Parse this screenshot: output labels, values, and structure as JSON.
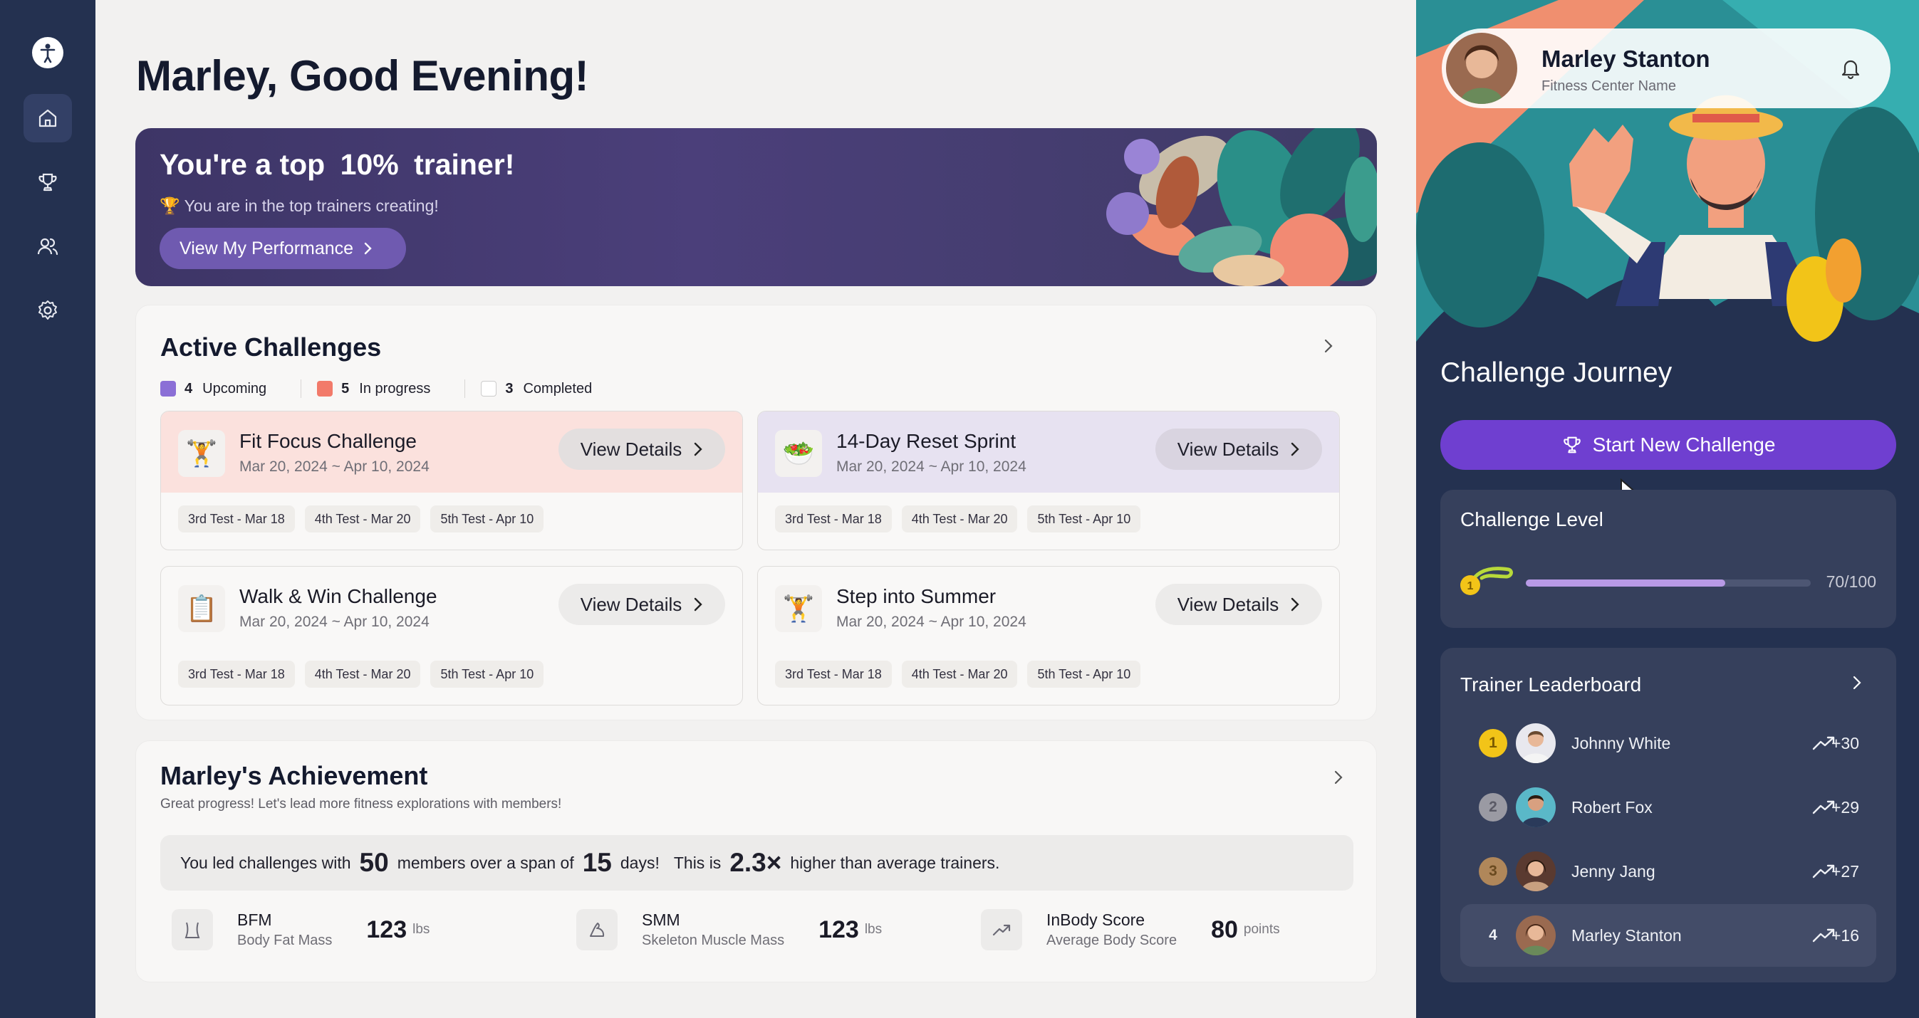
{
  "user": {
    "first_name_greeting": "Marley, Good Evening!",
    "full_name": "Marley Stanton",
    "center": "Fitness Center Name"
  },
  "sidebar": {
    "items": [
      {
        "name": "home-icon",
        "active": true
      },
      {
        "name": "trophy-icon"
      },
      {
        "name": "users-icon"
      },
      {
        "name": "gear-icon"
      }
    ]
  },
  "banner": {
    "title_prefix": "You're a top",
    "title_pct": "10%",
    "title_suffix": "trainer!",
    "subtitle": "You are in the top trainers creating!",
    "button": "View My Performance"
  },
  "active_challenges": {
    "title": "Active Challenges",
    "legend": [
      {
        "count": "4",
        "label": "Upcoming",
        "color": "#8b6fd6"
      },
      {
        "count": "5",
        "label": "In progress",
        "color": "#f27a6a"
      },
      {
        "count": "3",
        "label": "Completed",
        "color": "#ffffff"
      }
    ],
    "items": [
      {
        "name": "Fit Focus Challenge",
        "date": "Mar 20, 2024 ~ Apr 10, 2024",
        "button": "View Details",
        "icon": "weightlifter-icon",
        "tags": [
          "3rd Test - Mar 18",
          "4th Test - Mar 20",
          "5th Test - Apr 10"
        ]
      },
      {
        "name": "14-Day Reset Sprint",
        "date": "Mar 20, 2024 ~ Apr 10, 2024",
        "button": "View Details",
        "icon": "salad-bowl-icon",
        "tags": [
          "3rd Test - Mar 18",
          "4th Test - Mar 20",
          "5th Test - Apr 10"
        ]
      },
      {
        "name": "Walk & Win Challenge",
        "date": "Mar 20, 2024 ~ Apr 10, 2024",
        "button": "View Details",
        "icon": "clipboard-100-icon",
        "tags": [
          "3rd Test - Mar 18",
          "4th Test - Mar 20",
          "5th Test - Apr 10"
        ]
      },
      {
        "name": "Step into Summer",
        "date": "Mar 20, 2024 ~ Apr 10, 2024",
        "button": "View Details",
        "icon": "weightlifter-icon",
        "tags": [
          "3rd Test - Mar 18",
          "4th Test - Mar 20",
          "5th Test - Apr 10"
        ]
      }
    ]
  },
  "achievement": {
    "title": "Marley's Achievement",
    "subtitle": "Great progress! Let's lead more fitness explorations with members!",
    "sentence": {
      "a": "You led challenges with",
      "members": "50",
      "b": "members over a span of",
      "days": "15",
      "c": "days!",
      "d": "This is",
      "mult": "2.3×",
      "e": "higher than average trainers."
    },
    "metrics": [
      {
        "label": "BFM",
        "sub": "Body Fat Mass",
        "value": "123",
        "unit": "lbs",
        "icon": "body-fat-icon"
      },
      {
        "label": "SMM",
        "sub": "Skeleton Muscle Mass",
        "value": "123",
        "unit": "lbs",
        "icon": "muscle-arm-icon"
      },
      {
        "label": "InBody Score",
        "sub": "Average Body Score",
        "value": "80",
        "unit": "points",
        "icon": "trend-up-icon"
      }
    ]
  },
  "journey": {
    "title": "Challenge Journey",
    "start_button": "Start New Challenge",
    "level": {
      "title": "Challenge Level",
      "value": 70,
      "max": 100,
      "label": "70/100"
    },
    "leaderboard": {
      "title": "Trainer Leaderboard",
      "rows": [
        {
          "rank": "1",
          "name": "Johnny White",
          "points": "+30",
          "rank_color": "#f2c418"
        },
        {
          "rank": "2",
          "name": "Robert Fox",
          "points": "+29",
          "rank_color": "#9a9aa3"
        },
        {
          "rank": "3",
          "name": "Jenny Jang",
          "points": "+27",
          "rank_color": "#b0875a"
        },
        {
          "rank": "4",
          "name": "Marley Stanton",
          "points": "+16",
          "rank_color": "transparent"
        }
      ]
    }
  },
  "colors": {
    "accent": "#6f3fd0",
    "sidebar": "#243150",
    "panel": "#36405c"
  }
}
